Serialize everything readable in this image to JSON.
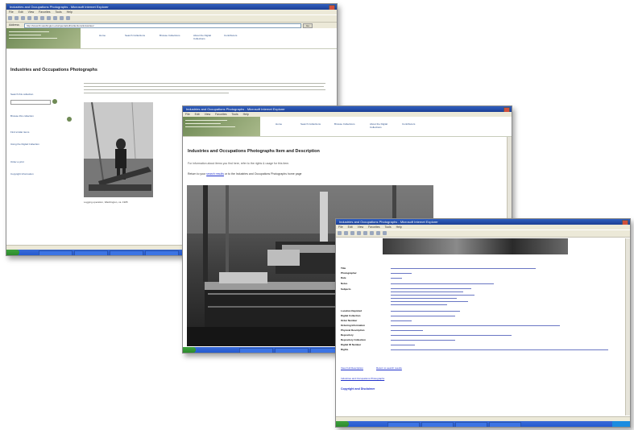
{
  "windows": [
    {
      "id": "window1",
      "title": "Industries and Occupations Photographs - Microsoft Internet Explorer",
      "menu": [
        "File",
        "Edit",
        "View",
        "Favorites",
        "Tools",
        "Help"
      ],
      "address_label": "Address",
      "address": "http://www.lib.washington.edu/specialcoll/collections/industries/",
      "go_label": "Go",
      "nav": [
        "Home",
        "Search Collections",
        "Browse Collections",
        "About the Digital Collections",
        "Contributors"
      ],
      "heading": "Industries and Occupations Photographs",
      "sidebar": [
        "Search this collection",
        "Browse this collection",
        "Find similar items",
        "Using the Digital Collection",
        "Order a print",
        "Copyright Information"
      ],
      "caption": "Logging operation, Washington, ca. 1905"
    },
    {
      "id": "window2",
      "title": "Industries and Occupations Photographs - Microsoft Internet Explorer",
      "menu": [
        "File",
        "Edit",
        "View",
        "Favorites",
        "Tools",
        "Help"
      ],
      "nav": [
        "Home",
        "Search Collections",
        "Browse Collections",
        "About the Digital Collections",
        "Contributors"
      ],
      "heading": "Industries and Occupations Photographs Item and Description",
      "intro": "For information about items you find here, refer to the rights & usage for this item.",
      "return_prefix": "Return to your",
      "return_link": "search results",
      "return_suffix": "or to the Industries and Occupations Photographs home page"
    },
    {
      "id": "window3",
      "title": "Industries and Occupations Photographs - Microsoft Internet Explorer",
      "menu": [
        "File",
        "Edit",
        "View",
        "Favorites",
        "Tools",
        "Help"
      ],
      "fields": [
        "Title",
        "Photographer",
        "Date",
        "Notes",
        "Subjects",
        "Location Depicted",
        "Digital Collection",
        "Order Number",
        "Ordering Information",
        "Physical Description",
        "Repository",
        "Repository Collection",
        "Digital ID Number",
        "Rights"
      ],
      "footer_link": "View Full Description",
      "footer_link2": "Return to search results",
      "footer_home": "Industries and Occupations Photographs",
      "bottom_link": "Copyright and Disclaimer"
    }
  ],
  "colors": {
    "titlebar": "#2f5fc0",
    "chrome": "#ece9d8",
    "banner_green": "#6f8a55",
    "link_blue": "#2233cc",
    "taskbar": "#245bd1"
  }
}
